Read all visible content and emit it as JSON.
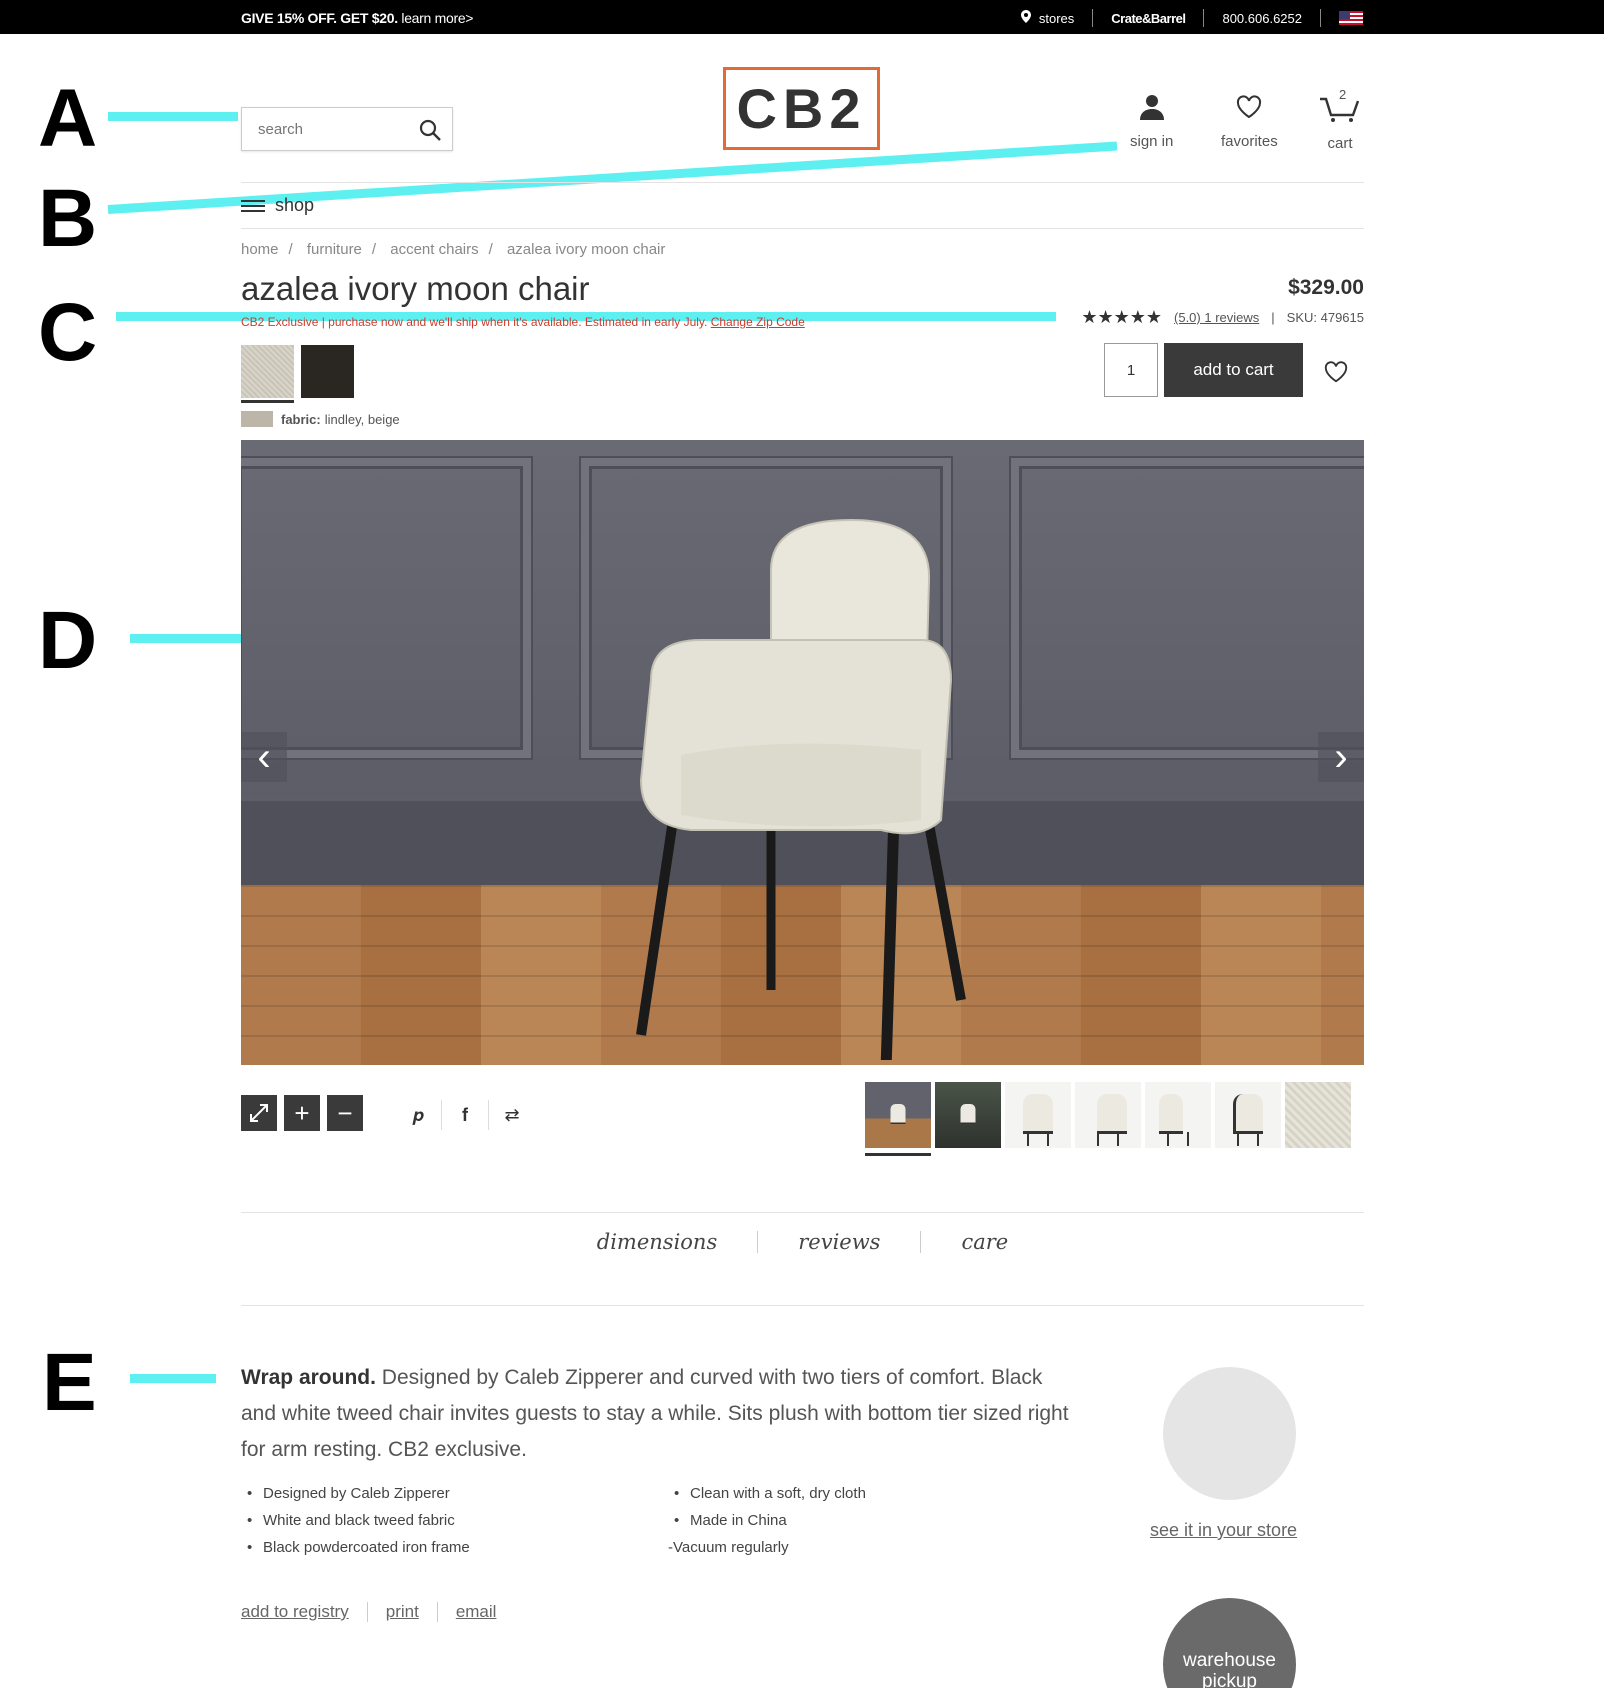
{
  "promo": {
    "text": "GIVE 15% OFF. GET $20.",
    "more": "learn more>"
  },
  "utility": {
    "stores": "stores",
    "sister_brand": "Crate&Barrel",
    "phone": "800.606.6252"
  },
  "search": {
    "placeholder": "search"
  },
  "logo": "CB2",
  "header_icons": {
    "sign_in": "sign in",
    "favorites": "favorites",
    "cart": "cart",
    "cart_count": "2"
  },
  "nav": {
    "shop": "shop"
  },
  "breadcrumb": [
    "home",
    "furniture",
    "accent chairs",
    "azalea ivory moon chair"
  ],
  "product": {
    "title": "azalea ivory moon chair",
    "price": "$329.00",
    "shipping_note": "CB2 Exclusive | purchase now and we'll ship when it's available. Estimated in early July.",
    "change_zip": "Change Zip Code",
    "stars": "★★★★★",
    "reviews": "(5.0) 1 reviews",
    "sku": "SKU: 479615",
    "fabric_label": "fabric:",
    "fabric_value": "lindley, beige",
    "quantity": "1",
    "add_to_cart": "add to cart"
  },
  "callouts": [
    "A",
    "B",
    "C",
    "D",
    "E"
  ],
  "tabs": [
    "dimensions",
    "reviews",
    "care"
  ],
  "description": {
    "lead": "Wrap around.",
    "body": " Designed by Caleb Zipperer and curved with two tiers of comfort. Black and white tweed chair invites guests to stay a while. Sits plush with bottom tier sized right for arm resting. CB2 exclusive."
  },
  "features_left": [
    "Designed by Caleb Zipperer",
    "White and black tweed fabric",
    "Black powdercoated iron frame"
  ],
  "features_right": [
    "Clean with a soft, dry cloth",
    "Made in China"
  ],
  "features_right_plain": "-Vacuum regularly",
  "links": {
    "registry": "add to registry",
    "print": "print",
    "email": "email"
  },
  "store": {
    "see_in_store": "see it in your store",
    "warehouse_line1": "warehouse",
    "warehouse_line2": "pickup"
  },
  "colors": {
    "accent_logo": "#e26a37",
    "callout": "#5ef0f0",
    "topbar": "#000000"
  }
}
